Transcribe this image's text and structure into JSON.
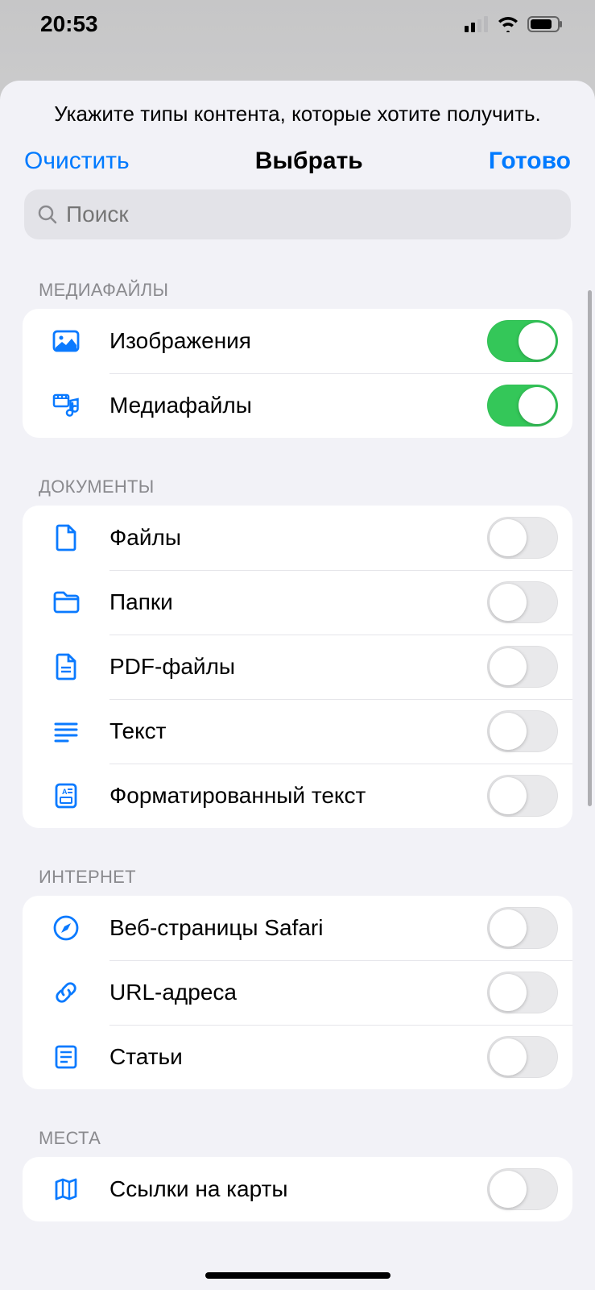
{
  "status": {
    "time": "20:53"
  },
  "sheet": {
    "subtitle": "Укажите типы контента, которые хотите получить.",
    "clear": "Очистить",
    "title": "Выбрать",
    "done": "Готово",
    "search_placeholder": "Поиск"
  },
  "sections": {
    "media": {
      "header": "МЕДИАФАЙЛЫ",
      "img": "Изображения",
      "media": "Медиафайлы"
    },
    "docs": {
      "header": "ДОКУМЕНТЫ",
      "files": "Файлы",
      "folders": "Папки",
      "pdf": "PDF-файлы",
      "text": "Текст",
      "rich": "Форматированный текст"
    },
    "internet": {
      "header": "ИНТЕРНЕТ",
      "safari": "Веб-страницы Safari",
      "urls": "URL-адреса",
      "articles": "Статьи"
    },
    "places": {
      "header": "МЕСТА",
      "maplinks": "Ссылки на карты"
    }
  },
  "toggles": {
    "img": true,
    "media": true,
    "files": false,
    "folders": false,
    "pdf": false,
    "text": false,
    "rich": false,
    "safari": false,
    "urls": false,
    "articles": false,
    "maplinks": false
  },
  "colors": {
    "accent": "#007aff",
    "green": "#34c759",
    "icon": "#0a7aff"
  }
}
